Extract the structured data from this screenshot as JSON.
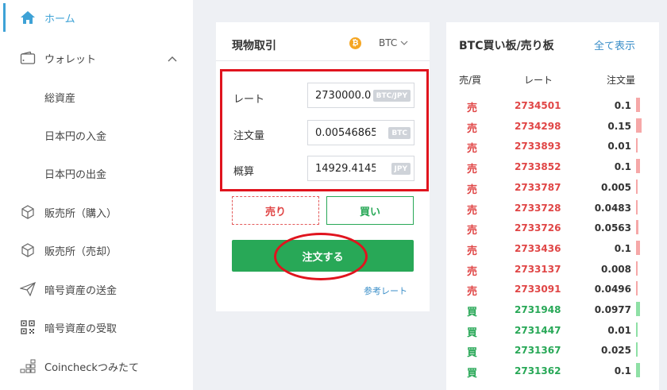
{
  "sidebar": {
    "items": [
      {
        "label": "ホーム",
        "icon": "home-icon",
        "active": true
      },
      {
        "label": "ウォレット",
        "icon": "wallet-icon",
        "expanded": true
      },
      {
        "label": "総資産",
        "sub": true
      },
      {
        "label": "日本円の入金",
        "sub": true
      },
      {
        "label": "日本円の出金",
        "sub": true
      },
      {
        "label": "販売所（購入）",
        "icon": "cube-icon"
      },
      {
        "label": "販売所（売却）",
        "icon": "cube-icon"
      },
      {
        "label": "暗号資産の送金",
        "icon": "send-icon"
      },
      {
        "label": "暗号資産の受取",
        "icon": "qr-code-icon"
      },
      {
        "label": "Coincheckつみたて",
        "icon": "grid-icon"
      }
    ]
  },
  "order": {
    "title": "現物取引",
    "coin_symbol": "₿",
    "pair": "BTC",
    "rate_label": "レート",
    "rate_value": "2730000.0",
    "rate_unit": "BTC/JPY",
    "amount_label": "注文量",
    "amount_value": "0.00546865",
    "amount_unit": "BTC",
    "estimate_label": "概算",
    "estimate_value": "14929.4145",
    "estimate_unit": "JPY",
    "sell_label": "売り",
    "buy_label": "買い",
    "submit_label": "注文する",
    "reference_label": "参考レート"
  },
  "book": {
    "title": "BTC買い板/売り板",
    "show_all": "全て表示",
    "headers": {
      "side": "売/買",
      "rate": "レート",
      "qty": "注文量"
    },
    "sell_label": "売",
    "buy_label": "買",
    "rows": [
      {
        "side": "売",
        "price": "2734501",
        "qty": "0.1",
        "depth": 0.1
      },
      {
        "side": "売",
        "price": "2734298",
        "qty": "0.15",
        "depth": 0.15
      },
      {
        "side": "売",
        "price": "2733893",
        "qty": "0.01",
        "depth": 0.01
      },
      {
        "side": "売",
        "price": "2733852",
        "qty": "0.1",
        "depth": 0.1
      },
      {
        "side": "売",
        "price": "2733787",
        "qty": "0.005",
        "depth": 0.005
      },
      {
        "side": "売",
        "price": "2733728",
        "qty": "0.0483",
        "depth": 0.0483
      },
      {
        "side": "売",
        "price": "2733726",
        "qty": "0.0563",
        "depth": 0.0563
      },
      {
        "side": "売",
        "price": "2733436",
        "qty": "0.1",
        "depth": 0.1
      },
      {
        "side": "売",
        "price": "2733137",
        "qty": "0.008",
        "depth": 0.008
      },
      {
        "side": "売",
        "price": "2733091",
        "qty": "0.0496",
        "depth": 0.0496
      },
      {
        "side": "買",
        "price": "2731948",
        "qty": "0.0977",
        "depth": 0.0977
      },
      {
        "side": "買",
        "price": "2731447",
        "qty": "0.01",
        "depth": 0.01
      },
      {
        "side": "買",
        "price": "2731367",
        "qty": "0.025",
        "depth": 0.025
      },
      {
        "side": "買",
        "price": "2731362",
        "qty": "0.1",
        "depth": 0.1
      }
    ]
  },
  "colors": {
    "accent": "#3ea2d6",
    "ask": "#e04646",
    "ask_bar": "#f6a8a8",
    "bid": "#28a857",
    "bid_bar": "#8fe0a6",
    "highlight": "#e0141e"
  }
}
